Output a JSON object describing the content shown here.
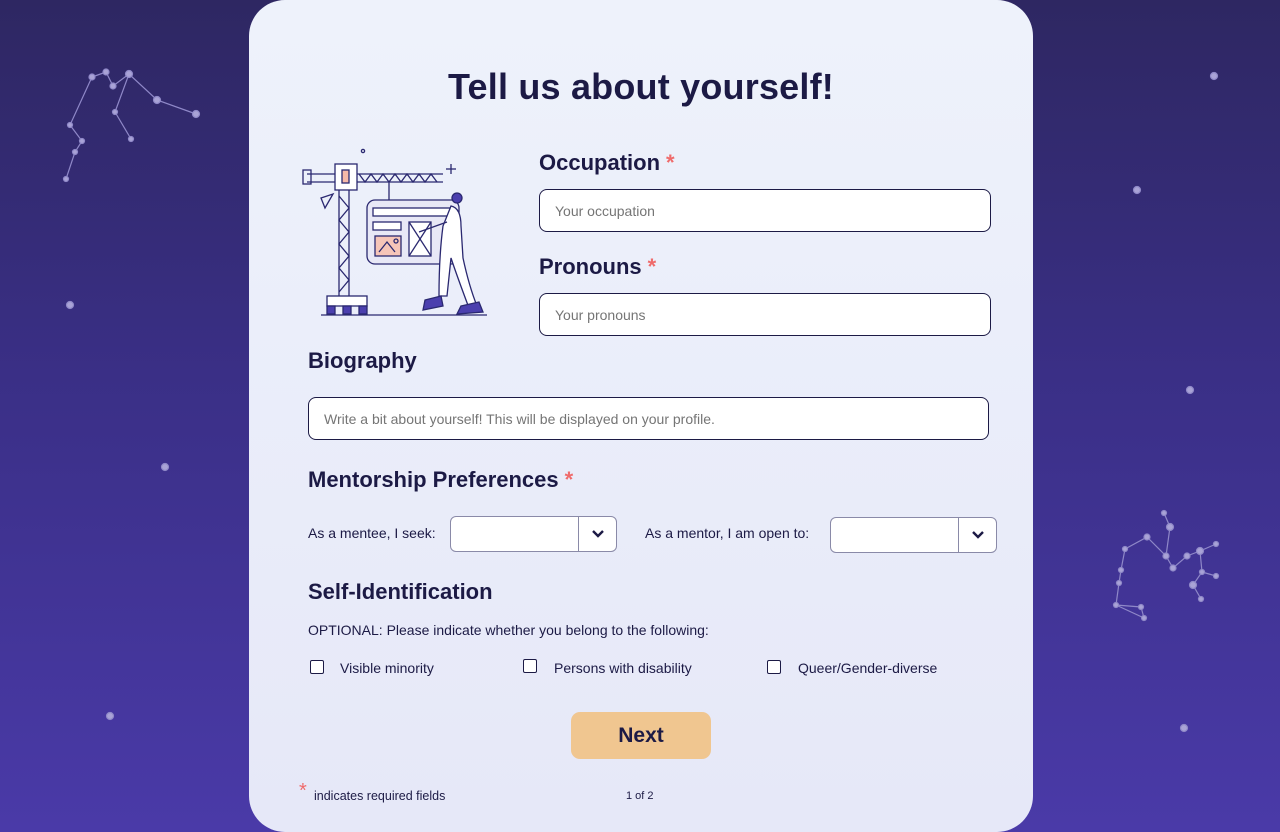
{
  "form": {
    "title": "Tell us about yourself!",
    "occupation": {
      "label": "Occupation",
      "required_mark": "*",
      "placeholder": "Your occupation"
    },
    "pronouns": {
      "label": "Pronouns",
      "required_mark": "*",
      "placeholder": "Your pronouns"
    },
    "biography": {
      "label": "Biography",
      "placeholder": "Write a bit about yourself! This will be displayed on your profile."
    },
    "mentorship": {
      "label": "Mentorship Preferences",
      "required_mark": "*",
      "mentee_label": "As a mentee, I seek:",
      "mentor_label": "As a mentor, I am open to:",
      "mentee_value": "",
      "mentor_value": ""
    },
    "self_identification": {
      "label": "Self-Identification",
      "optional_text": "OPTIONAL: Please indicate whether you belong to the following:",
      "options": [
        {
          "label": "Visible minority",
          "checked": false
        },
        {
          "label": "Persons with disability",
          "checked": false
        },
        {
          "label": "Queer/Gender-diverse",
          "checked": false
        }
      ]
    },
    "next_label": "Next",
    "required_note_mark": "*",
    "required_note": "indicates required fields",
    "page_indicator": "1 of 2"
  },
  "colors": {
    "background_top": "#2e2762",
    "background_bottom": "#4a3aa8",
    "card": "#eef2fb",
    "text": "#1c1a45",
    "required": "#ef6b6b",
    "next_button": "#f0c690",
    "illustration_accent": "#4b3fae"
  },
  "icons": [
    "chevron-down-icon",
    "crane-illustration",
    "constellation-decoration"
  ]
}
